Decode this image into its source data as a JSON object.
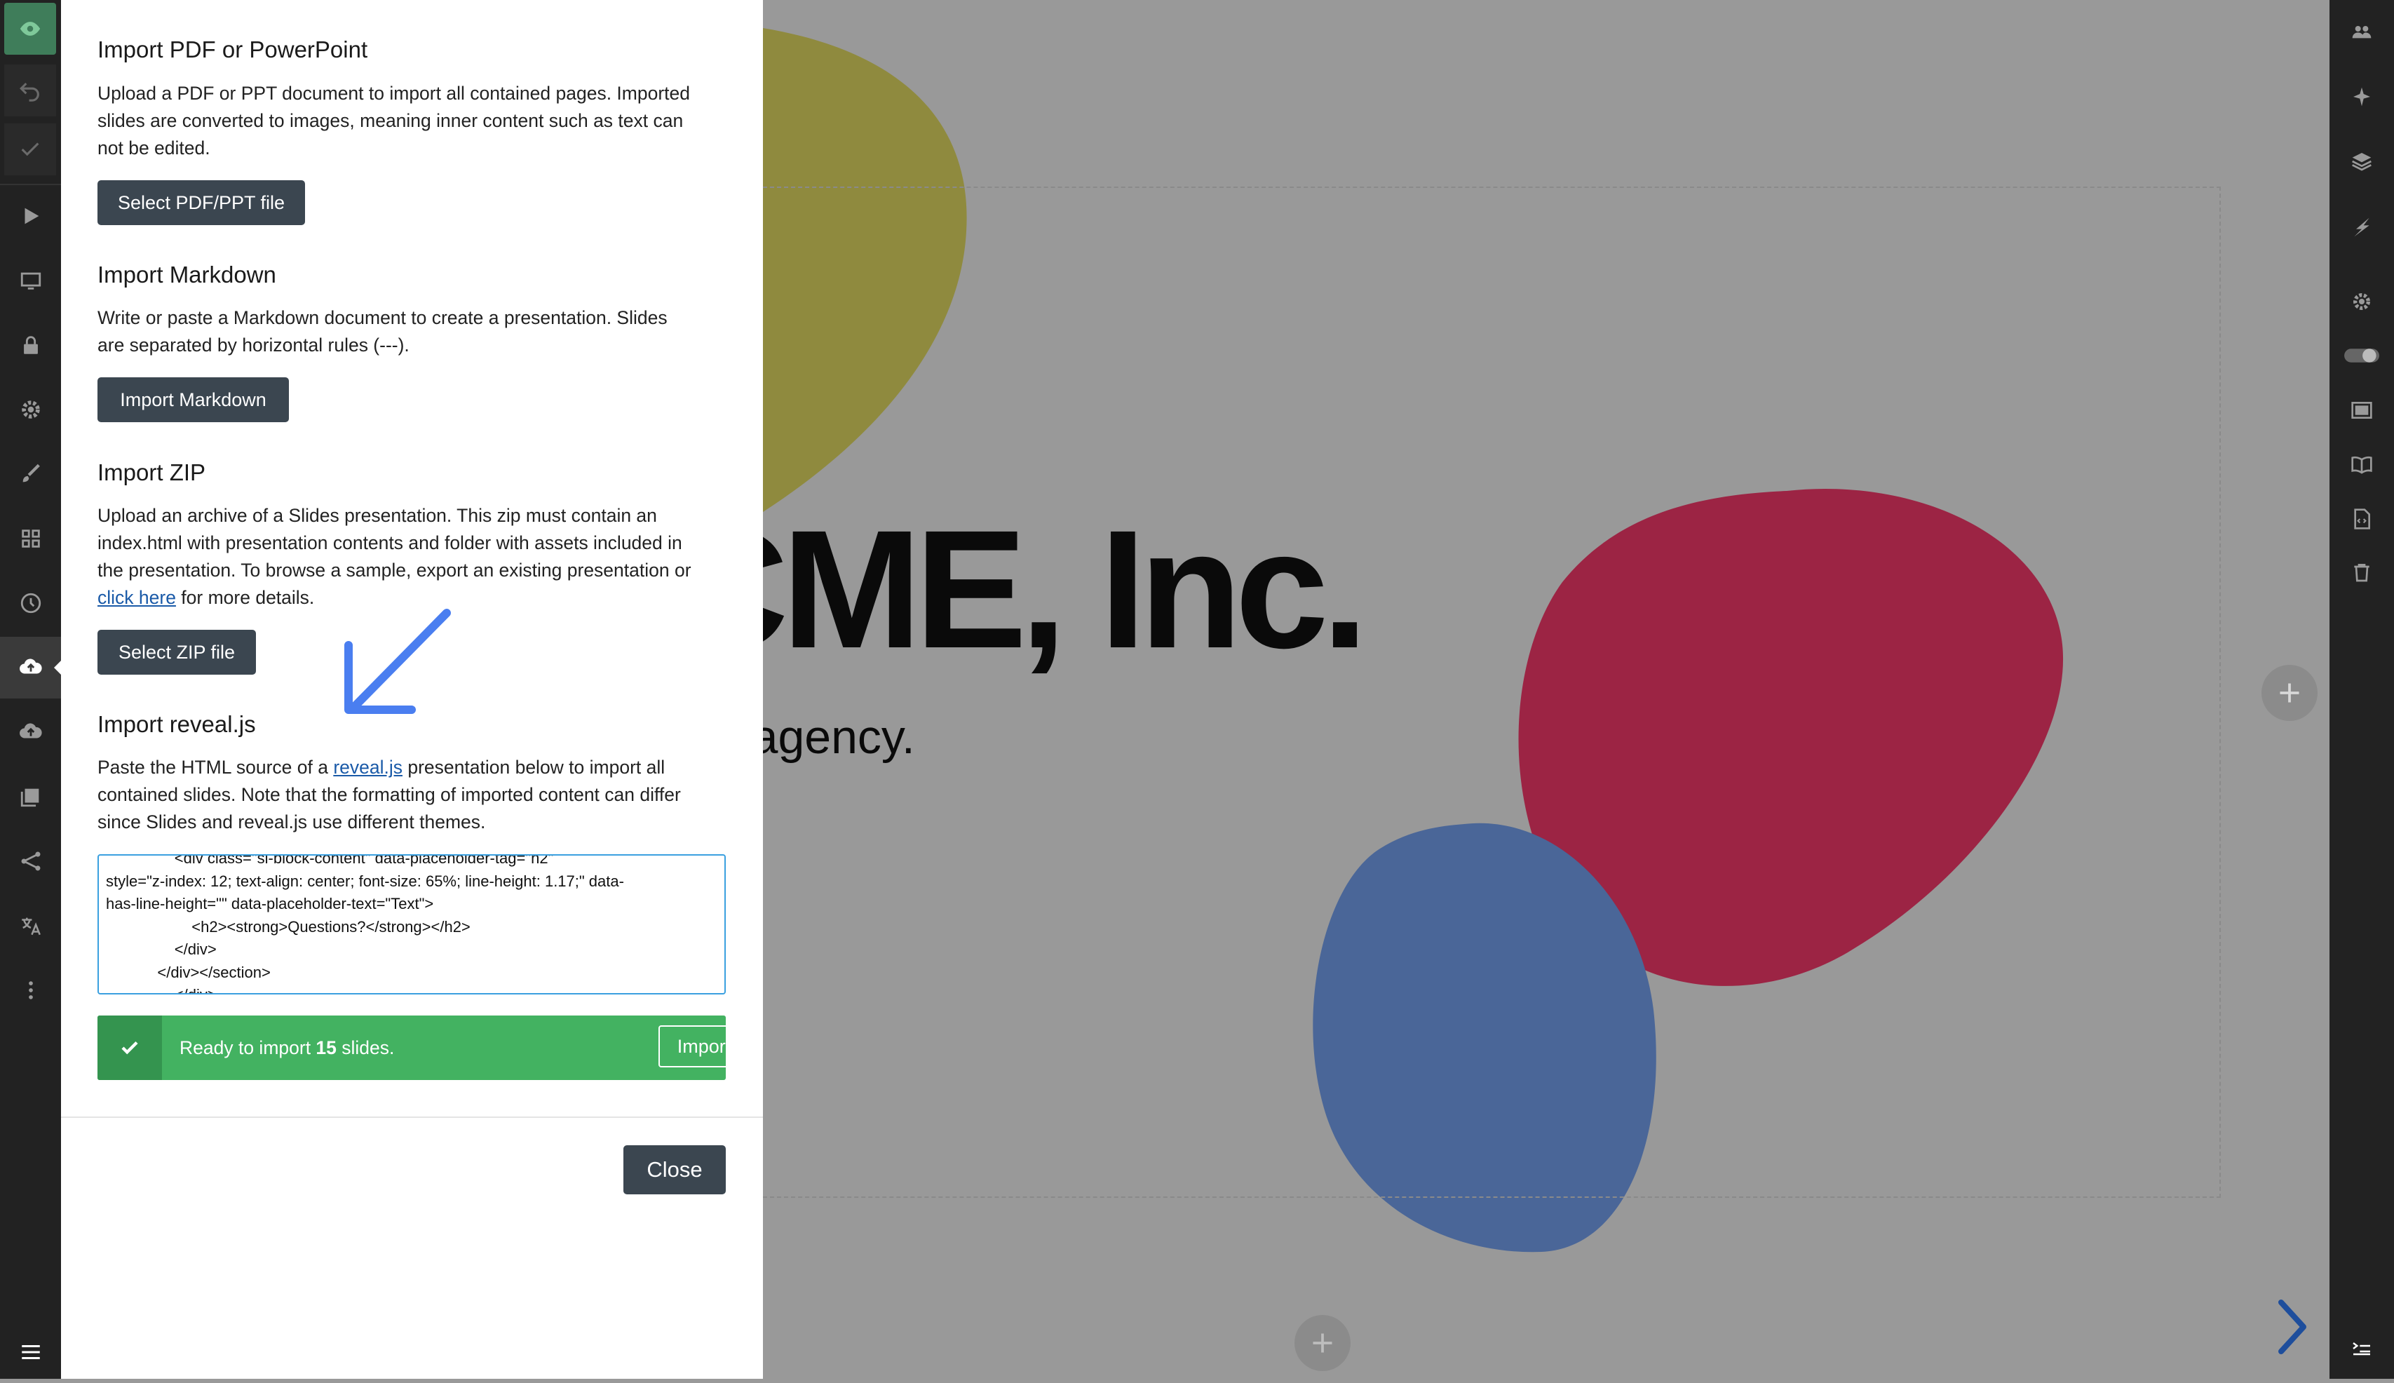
{
  "import_panel": {
    "pdf": {
      "heading": "Import PDF or PowerPoint",
      "lines": [
        "Upload a PDF or PPT document to import all contained pages. Imported",
        "slides are converted to images, meaning inner content such as text can",
        "not be edited."
      ],
      "button": "Select PDF/PPT file"
    },
    "markdown": {
      "heading": "Import Markdown",
      "lines": [
        "Write or paste a Markdown document to create a presentation. Slides",
        "are separated by horizontal rules (---)."
      ],
      "button": "Import Markdown"
    },
    "zip": {
      "heading": "Import ZIP",
      "lines": [
        "Upload an archive of a Slides presentation. This zip must contain an",
        "index.html with presentation contents and folder with assets included in",
        "the presentation. To browse a sample, export an existing presentation or"
      ],
      "link": "click here",
      "after_link": " for more details.",
      "button": "Select ZIP file"
    },
    "reveal": {
      "heading": "Import reveal.js",
      "line1_before": "Paste the HTML source of a ",
      "line1_link": "reveal.js",
      "line1_after": " presentation below to import all",
      "lines": [
        "contained slides. Note that the formatting of imported content can differ",
        "since Slides and reveal.js use different themes."
      ],
      "source": "                <div class=\"sl-block-content\" data-placeholder-tag=\"h2\"\nstyle=\"z-index: 12; text-align: center; font-size: 65%; line-height: 1.17;\" data-\nhas-line-height=\"\" data-placeholder-text=\"Text\">\n                    <h2><strong>Questions?</strong></h2>\n                </div>\n            </div></section>\n                </div>",
      "status_prefix": "Ready to import ",
      "status_count": "15",
      "status_suffix": " slides.",
      "import_button": "Import"
    },
    "close_button": "Close"
  },
  "slide": {
    "title": "ACME, Inc.",
    "subtitle": "A full-service design agency."
  },
  "colors": {
    "yellow_blob": "#8f8a3e",
    "red_blob": "#9c2444",
    "blue_blob": "#4a6698",
    "success": "#43b261",
    "dark_button": "#3b4650",
    "link": "#1a5aa8",
    "annotation_arrow": "#4a7ef0"
  },
  "left_toolbar": [
    "preview-icon",
    "undo-icon",
    "save-check-icon",
    "present-icon",
    "display-icon",
    "lock-icon",
    "settings-icon",
    "brush-icon",
    "grid-icon",
    "history-icon",
    "import-upload-icon",
    "export-upload-icon",
    "media-library-icon",
    "share-icon",
    "translate-icon",
    "more-icon",
    "menu-icon"
  ],
  "right_toolbar": [
    "collaborators-icon",
    "magic-icon",
    "layers-icon",
    "lightning-icon",
    "gear-icon",
    "toggle-icon",
    "slide-background-icon",
    "notes-book-icon",
    "code-file-icon",
    "trash-icon",
    "speaker-notes-icon"
  ]
}
